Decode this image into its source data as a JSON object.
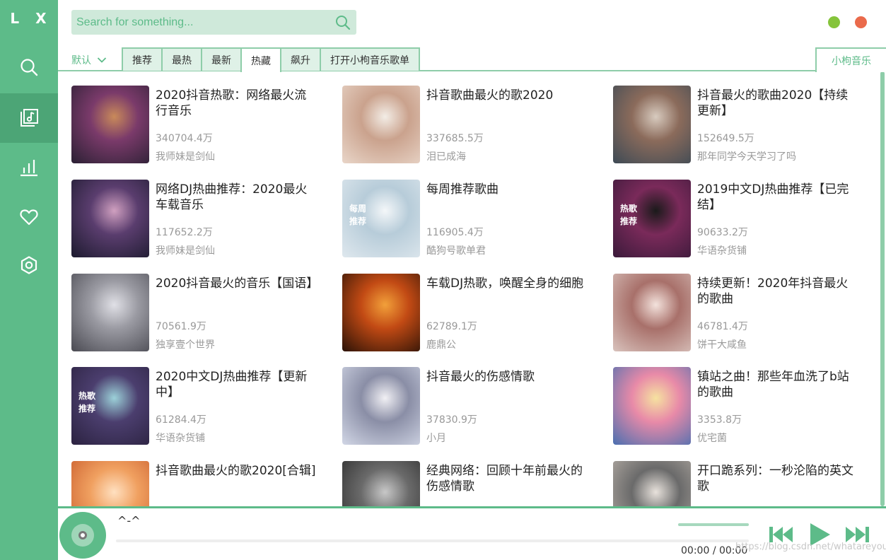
{
  "app": {
    "logo": "L X"
  },
  "sidebar": {
    "items": [
      {
        "name": "search",
        "icon": "search-icon"
      },
      {
        "name": "playlist",
        "icon": "music-list-icon",
        "active": true
      },
      {
        "name": "charts",
        "icon": "bar-chart-icon"
      },
      {
        "name": "favorites",
        "icon": "heart-icon"
      },
      {
        "name": "settings",
        "icon": "settings-icon"
      }
    ]
  },
  "search": {
    "placeholder": "Search for something..."
  },
  "sort": {
    "label": "默认"
  },
  "tabs": [
    "推荐",
    "最热",
    "最新",
    "热藏",
    "飙升",
    "打开小枸音乐歌单"
  ],
  "active_tab": "热藏",
  "source": {
    "label": "小枸音乐"
  },
  "colors": {
    "accent": "#5dbb89",
    "accent_dark": "#4ca576",
    "light": "#dff1e7",
    "min": "#85c43b",
    "close": "#ea6a4b"
  },
  "playlists": [
    {
      "title": "2020抖音热歌：网络最火流行音乐",
      "count": "340704.4万",
      "author": "我师妹是剑仙"
    },
    {
      "title": "抖音歌曲最火的歌2020",
      "count": "337685.5万",
      "author": "泪已成海"
    },
    {
      "title": "抖音最火的歌曲2020【持续更新】",
      "count": "152649.5万",
      "author": "那年同学今天学习了吗"
    },
    {
      "title": "网络DJ热曲推荐：2020最火车载音乐",
      "count": "117652.2万",
      "author": "我师妹是剑仙"
    },
    {
      "title": "每周推荐歌曲",
      "count": "116905.4万",
      "author": "酷狗号歌单君",
      "cover_text": "每周推荐"
    },
    {
      "title": "2019中文DJ热曲推荐【已完结】",
      "count": "90633.2万",
      "author": "华语杂货铺",
      "cover_text": "热歌推荐"
    },
    {
      "title": "2020抖音最火的音乐【国语】",
      "count": "70561.9万",
      "author": "独享壹个世界"
    },
    {
      "title": "车载DJ热歌，唤醒全身的细胞",
      "count": "62789.1万",
      "author": "鹿鼎公"
    },
    {
      "title": "持续更新！2020年抖音最火的歌曲",
      "count": "46781.4万",
      "author": "饼干大咸鱼"
    },
    {
      "title": "2020中文DJ热曲推荐【更新中】",
      "count": "61284.4万",
      "author": "华语杂货铺",
      "cover_text": "热歌推荐"
    },
    {
      "title": "抖音最火的伤感情歌",
      "count": "37830.9万",
      "author": "小月"
    },
    {
      "title": "镇站之曲！那些年血洗了b站的歌曲",
      "count": "3353.8万",
      "author": "优宅菌"
    },
    {
      "title": "抖音歌曲最火的歌2020[合辑]",
      "count": "",
      "author": ""
    },
    {
      "title": "经典网络：回顾十年前最火的伤感情歌",
      "count": "",
      "author": ""
    },
    {
      "title": "开口跪系列：一秒沦陷的英文歌",
      "count": "",
      "author": ""
    }
  ],
  "player": {
    "track": "^-^",
    "current_time": "00:00",
    "separator": "/",
    "total_time": "00:00",
    "progress": 0,
    "volume": 1
  },
  "watermark": "https://blog.csdn.net/whatareyougoo"
}
